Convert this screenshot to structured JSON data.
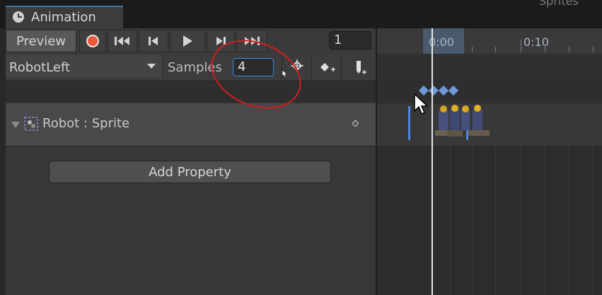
{
  "window": {
    "tab_title": "Animation",
    "corner_text": "Sprites"
  },
  "toolbar": {
    "preview_label": "Preview",
    "current_frame": "1"
  },
  "clip": {
    "name": "RobotLeft",
    "samples_label": "Samples",
    "samples_value": "4"
  },
  "track": {
    "label": "Robot : Sprite"
  },
  "actions": {
    "add_property_label": "Add Property"
  },
  "timeline": {
    "ruler_labels": [
      "0:00",
      "0:10"
    ],
    "keyframe_count": 4
  },
  "colors": {
    "accent_blue": "#4f86e0",
    "record_red": "#f05a3c",
    "annotation_red": "#d41c1c"
  },
  "icons": [
    "animation-window-icon",
    "record-icon",
    "first-frame-icon",
    "prev-frame-icon",
    "play-icon",
    "next-frame-icon",
    "last-frame-icon",
    "keyframe-filter-icon",
    "add-keyframe-icon",
    "add-event-icon",
    "sprite-icon"
  ]
}
